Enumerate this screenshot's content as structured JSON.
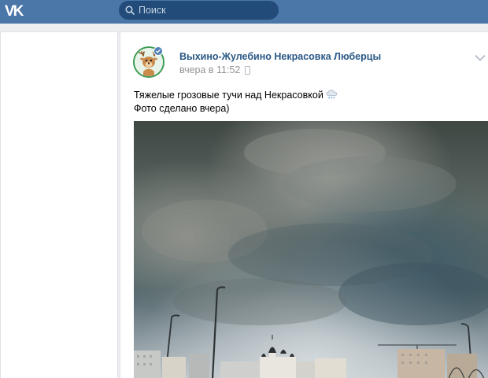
{
  "app": {
    "logo_text": "VK",
    "accent_color": "#4a76a8"
  },
  "search": {
    "placeholder": "Поиск"
  },
  "post": {
    "author": "Выхино-Жулебино Некрасовка Люберцы",
    "time": "вчера в 11:52",
    "posted_from_icon": "phone-icon",
    "menu_icon": "chevron-down-icon",
    "text_lines": [
      "Тяжелые грозовые тучи над Некрасовкой",
      "Фото сделано вчера)"
    ],
    "emoji_icon": "rain-cloud-icon",
    "avatar_icon": "deer-avatar-icon",
    "verified": true,
    "photo": "storm clouds over buildings and church"
  }
}
